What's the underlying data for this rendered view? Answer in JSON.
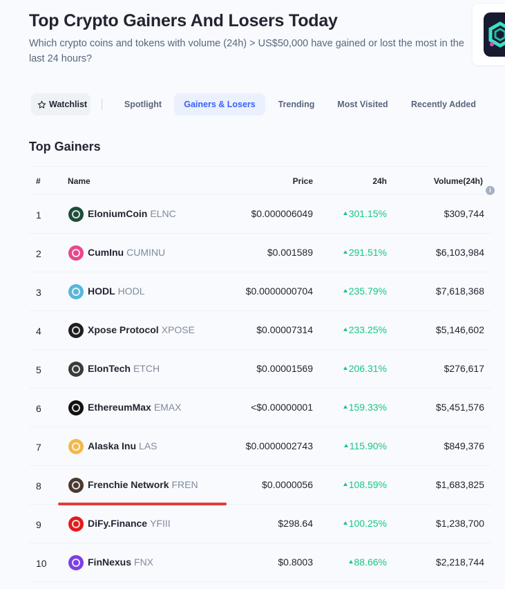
{
  "page": {
    "title": "Top Crypto Gainers And Losers Today",
    "description": "Which crypto coins and tokens with volume (24h) > US$50,000 have gained or lost the most in the last 24 hours?"
  },
  "promo": {
    "icon": "app-logo-icon"
  },
  "tabs": {
    "watchlist_label": "Watchlist",
    "items": [
      {
        "label": "Spotlight",
        "active": false
      },
      {
        "label": "Gainers & Losers",
        "active": true
      },
      {
        "label": "Trending",
        "active": false
      },
      {
        "label": "Most Visited",
        "active": false
      },
      {
        "label": "Recently Added",
        "active": false
      }
    ]
  },
  "gainers": {
    "title": "Top Gainers",
    "columns": {
      "rank": "#",
      "name": "Name",
      "price": "Price",
      "change": "24h",
      "volume": "Volume(24h)"
    },
    "rows": [
      {
        "rank": "1",
        "name": "EloniumCoin",
        "symbol": "ELNC",
        "price": "$0.000006049",
        "change": "301.15%",
        "volume": "$309,744",
        "logo_color": "#1f4d3a"
      },
      {
        "rank": "2",
        "name": "CumInu",
        "symbol": "CUMINU",
        "price": "$0.001589",
        "change": "291.51%",
        "volume": "$6,103,984",
        "logo_color": "#e8478b"
      },
      {
        "rank": "3",
        "name": "HODL",
        "symbol": "HODL",
        "price": "$0.0000000704",
        "change": "235.79%",
        "volume": "$7,618,368",
        "logo_color": "#58b7d8"
      },
      {
        "rank": "4",
        "name": "Xpose Protocol",
        "symbol": "XPOSE",
        "price": "$0.00007314",
        "change": "233.25%",
        "volume": "$5,146,602",
        "logo_color": "#1e1e1e"
      },
      {
        "rank": "5",
        "name": "ElonTech",
        "symbol": "ETCH",
        "price": "$0.00001569",
        "change": "206.31%",
        "volume": "$276,617",
        "logo_color": "#3a3a3a"
      },
      {
        "rank": "6",
        "name": "EthereumMax",
        "symbol": "EMAX",
        "price": "<$0.00000001",
        "change": "159.33%",
        "volume": "$5,451,576",
        "logo_color": "#111111"
      },
      {
        "rank": "7",
        "name": "Alaska Inu",
        "symbol": "LAS",
        "price": "$0.0000002743",
        "change": "115.90%",
        "volume": "$849,376",
        "logo_color": "#f2b84b"
      },
      {
        "rank": "8",
        "name": "Frenchie Network",
        "symbol": "FREN",
        "price": "$0.0000056",
        "change": "108.59%",
        "volume": "$1,683,825",
        "logo_color": "#4a3a2e"
      },
      {
        "rank": "9",
        "name": "DiFy.Finance",
        "symbol": "YFIII",
        "price": "$298.64",
        "change": "100.25%",
        "volume": "$1,238,700",
        "logo_color": "#e21b1b"
      },
      {
        "rank": "10",
        "name": "FinNexus",
        "symbol": "FNX",
        "price": "$0.8003",
        "change": "88.66%",
        "volume": "$2,218,744",
        "logo_color": "#7b3fe4"
      }
    ]
  },
  "colors": {
    "accent": "#3861fb",
    "positive": "#16c784",
    "highlight": "#e23b3b"
  }
}
